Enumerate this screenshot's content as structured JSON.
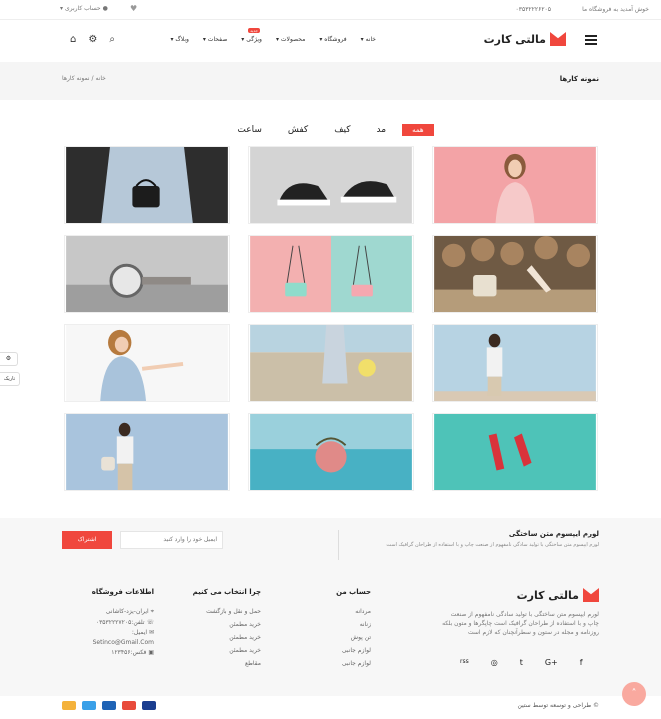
{
  "topbar": {
    "welcome": "خوش آمدید به فروشگاه ما",
    "phone": "۰۳۵۳۲۲۲۶۲۰۵",
    "account": "حساب کاربری",
    "account_arrow": "▾"
  },
  "header": {
    "logo_text": "مالتی کارت",
    "nav": [
      "خانه ▾",
      "فروشگاه ▾",
      "محصولات ▾",
      "ویژگی ▾",
      "صفحات ▾",
      "وبلاگ ▾"
    ],
    "new_badge": "جدید"
  },
  "breadcrumb": {
    "title": "نمونه کارها",
    "path": "خانه  /  نمونه کارها"
  },
  "filters": [
    "همه",
    "مد",
    "کیف",
    "کفش",
    "ساعت"
  ],
  "portfolio": [
    {
      "subject": "woman-pink",
      "bg": "#f3a3a6"
    },
    {
      "subject": "sneakers",
      "bg": "#cfcfcf"
    },
    {
      "subject": "bag-held",
      "bg": "#2b2b2b"
    },
    {
      "subject": "legs-bag",
      "bg": "#8a6b4d"
    },
    {
      "subject": "pastel-bags",
      "bg": "#f3b0b0"
    },
    {
      "subject": "watch",
      "bg": "#b9b9b9"
    },
    {
      "subject": "woman-blue",
      "bg": "#b7d3e3"
    },
    {
      "subject": "beach-walk",
      "bg": "#cbbfa8"
    },
    {
      "subject": "woman-pointing",
      "bg": "#f5f5f5"
    },
    {
      "subject": "red-shoes",
      "bg": "#4ec3b8"
    },
    {
      "subject": "beach-bag",
      "bg": "#5fb8c9"
    },
    {
      "subject": "woman-wall",
      "bg": "#a9c4dd"
    }
  ],
  "float_buttons": {
    "settings": "⚙",
    "dark": "تاریک"
  },
  "newsletter": {
    "title": "لورم ایپسوم متن ساختگی",
    "desc": "لورم ایپسوم متن ساختگی با تولید سادگی نامفهوم از صنعت چاپ و با استفاده از طراحان گرافیک است",
    "placeholder": "ایمیل خود را وارد کنید",
    "button": "اشتراک"
  },
  "footer": {
    "about_text": "لورم ایپسوم متن ساختگی با تولید سادگی نامفهوم از صنعت چاپ و با استفاده از طراحان گرافیک است چاپگرها و متون بلکه روزنامه و مجله در ستون و سطرآنچنان که لازم است",
    "account_title": "حساب من",
    "account_links": [
      "مردانه",
      "زنانه",
      "تن پوش",
      "لوازم جانبی",
      "لوازم جانبی"
    ],
    "why_title": "چرا انتخاب می کنیم",
    "why_links": [
      "حمل و نقل و بازگشت",
      "خرید مطمئن",
      "خرید مطمئن",
      "خرید مطمئن",
      "مقاطع"
    ],
    "info_title": "اطلاعات فروشگاه",
    "info": [
      "ایران-یزد-کاشانی",
      "تلفن:۰۳۵۳۲۲۲۷۲۰۵",
      "ایمیل:",
      "Setinco@Gmail.Com",
      "فکس:۱۲۳۴۵۶"
    ],
    "social": [
      "f",
      "G+",
      "t",
      "◎",
      "rss"
    ]
  },
  "bottom": {
    "copyright": "© طراحی و توسعه توسط ستین",
    "to_top": "˄"
  }
}
